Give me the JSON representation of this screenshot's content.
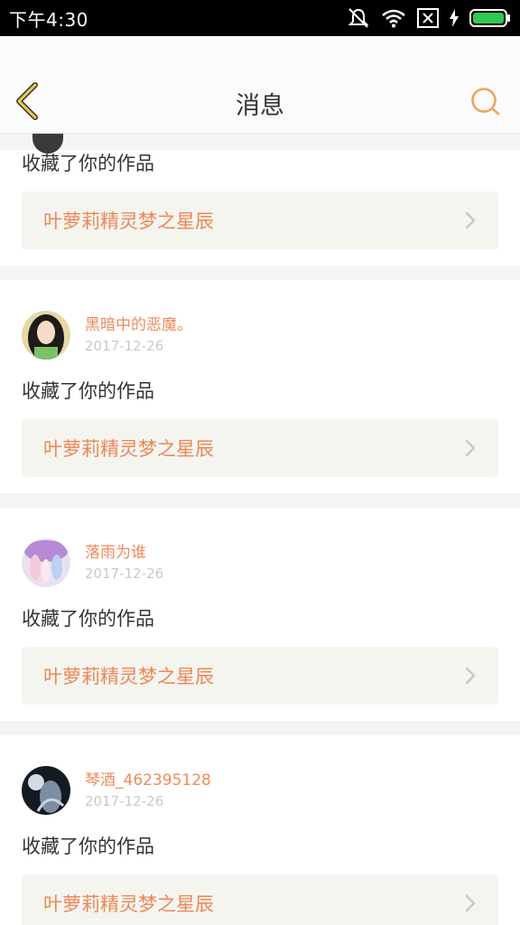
{
  "status_bar": {
    "time": "下午4:30",
    "icons": [
      "mute-icon",
      "wifi-icon",
      "sim-off-icon",
      "charging-icon",
      "battery-icon"
    ],
    "battery_color": "#32c850"
  },
  "header": {
    "title": "消息",
    "back_icon": "chevron-left-icon",
    "search_icon": "search-icon",
    "accent_color": "#f0a15a"
  },
  "notifications": [
    {
      "username": "",
      "date": "",
      "action": "收藏了你的作品",
      "work_title": "叶萝莉精灵梦之星辰"
    },
    {
      "username": "黑暗中的恶魔。",
      "date": "2017-12-26",
      "action": "收藏了你的作品",
      "work_title": "叶萝莉精灵梦之星辰"
    },
    {
      "username": "落雨为谁",
      "date": "2017-12-26",
      "action": "收藏了你的作品",
      "work_title": "叶萝莉精灵梦之星辰"
    },
    {
      "username": "琴酒_462395128",
      "date": "2017-12-26",
      "action": "收藏了你的作品",
      "work_title": "叶萝莉精灵梦之星辰"
    }
  ]
}
